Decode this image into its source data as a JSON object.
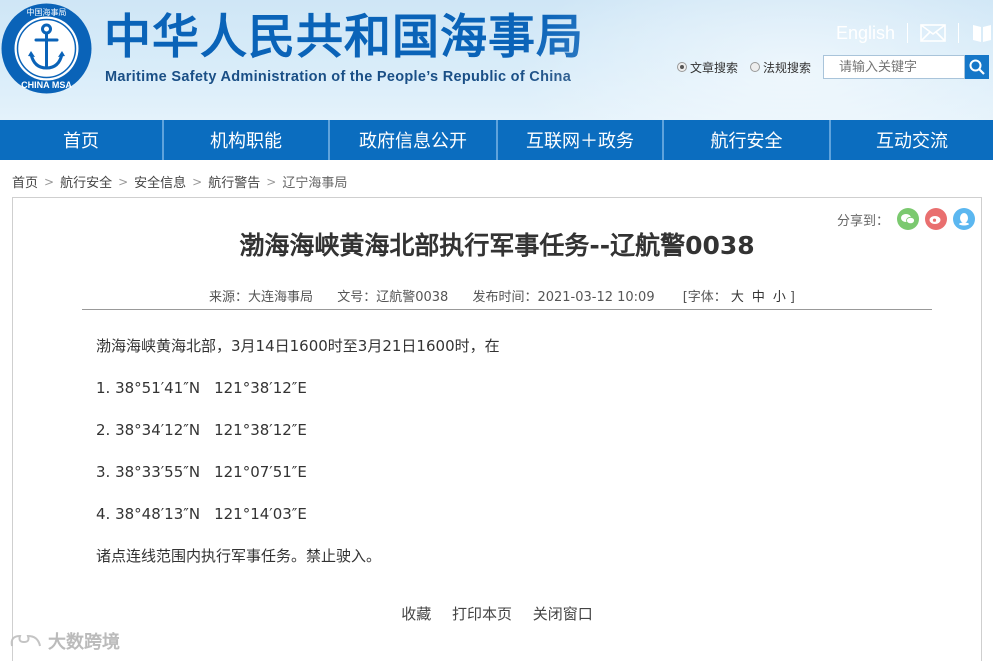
{
  "header": {
    "title_cn": "中华人民共和国海事局",
    "title_en": "Maritime Safety Administration of the People’s Republic of China",
    "logo_text_top": "中国海事局",
    "logo_text_bottom": "CHINA MSA",
    "english_link": "English",
    "search": {
      "options": [
        {
          "label": "文章搜索",
          "checked": true
        },
        {
          "label": "法规搜索",
          "checked": false
        }
      ],
      "placeholder": "请输入关键字"
    }
  },
  "nav": {
    "items": [
      "首页",
      "机构职能",
      "政府信息公开",
      "互联网＋政务",
      "航行安全",
      "互动交流"
    ]
  },
  "breadcrumb": [
    "首页",
    "航行安全",
    "安全信息",
    "航行警告",
    "辽宁海事局"
  ],
  "breadcrumb_sep": ">",
  "share": {
    "label": "分享到："
  },
  "article": {
    "title": "渤海海峡黄海北部执行军事任务--辽航警0038",
    "meta": {
      "source": "来源：大连海事局",
      "doc_no": "文号：辽航警0038",
      "publish_time": "发布时间：2021-03-12 10:09",
      "font_label": "[字体：",
      "font_large": "大",
      "font_medium": "中",
      "font_small": "小",
      "font_close": "]"
    },
    "intro": "渤海海峡黄海北部，3月14日1600时至3月21日1600时，在",
    "points": [
      {
        "num": "1.",
        "lat": "38°51′41″N",
        "lon": "121°38′12″E"
      },
      {
        "num": "2.",
        "lat": "38°34′12″N",
        "lon": "121°38′12″E"
      },
      {
        "num": "3.",
        "lat": "38°33′55″N",
        "lon": "121°07′51″E"
      },
      {
        "num": "4.",
        "lat": "38°48′13″N",
        "lon": "121°14′03″E"
      }
    ],
    "conclusion": "诸点连线范围内执行军事任务。禁止驶入。"
  },
  "footer_links": [
    "收藏",
    "打印本页",
    "关闭窗口"
  ],
  "watermark": "大数跨境",
  "colors": {
    "nav_bg": "#0b6dbf",
    "title_blue": "#0a63b8",
    "wechat_green": "#7bc96f",
    "weibo_red": "#e96f6f",
    "qq_blue": "#5bb7f0"
  }
}
